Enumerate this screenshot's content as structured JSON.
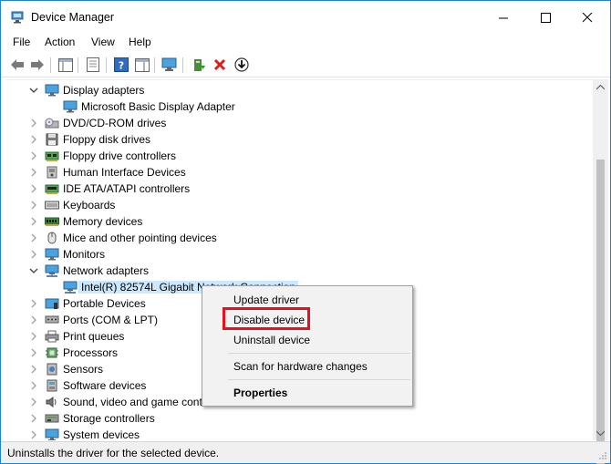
{
  "window": {
    "title": "Device Manager"
  },
  "menu": [
    "File",
    "Action",
    "View",
    "Help"
  ],
  "tree": [
    {
      "label": "Display adapters",
      "icon": "monitor-adapter-icon",
      "expanded": true,
      "level": 0
    },
    {
      "label": "Microsoft Basic Display Adapter",
      "icon": "monitor-adapter-icon",
      "level": 1
    },
    {
      "label": "DVD/CD-ROM drives",
      "icon": "dvd-drive-icon",
      "level": 0
    },
    {
      "label": "Floppy disk drives",
      "icon": "floppy-disk-icon",
      "level": 0
    },
    {
      "label": "Floppy drive controllers",
      "icon": "floppy-controller-icon",
      "level": 0
    },
    {
      "label": "Human Interface Devices",
      "icon": "hid-icon",
      "level": 0
    },
    {
      "label": "IDE ATA/ATAPI controllers",
      "icon": "ide-controller-icon",
      "level": 0
    },
    {
      "label": "Keyboards",
      "icon": "keyboard-icon",
      "level": 0
    },
    {
      "label": "Memory devices",
      "icon": "memory-icon",
      "level": 0
    },
    {
      "label": "Mice and other pointing devices",
      "icon": "mouse-icon",
      "level": 0
    },
    {
      "label": "Monitors",
      "icon": "monitor-icon",
      "level": 0
    },
    {
      "label": "Network adapters",
      "icon": "network-adapter-icon",
      "expanded": true,
      "level": 0
    },
    {
      "label": "Intel(R) 82574L Gigabit Network Connection",
      "icon": "network-adapter-icon",
      "level": 1,
      "selected": true
    },
    {
      "label": "Portable Devices",
      "icon": "portable-device-icon",
      "level": 0
    },
    {
      "label": "Ports (COM & LPT)",
      "icon": "port-icon",
      "level": 0
    },
    {
      "label": "Print queues",
      "icon": "printer-icon",
      "level": 0
    },
    {
      "label": "Processors",
      "icon": "processor-icon",
      "level": 0
    },
    {
      "label": "Sensors",
      "icon": "sensor-icon",
      "level": 0
    },
    {
      "label": "Software devices",
      "icon": "software-device-icon",
      "level": 0
    },
    {
      "label": "Sound, video and game controllers",
      "icon": "sound-icon",
      "level": 0
    },
    {
      "label": "Storage controllers",
      "icon": "storage-controller-icon",
      "level": 0
    },
    {
      "label": "System devices",
      "icon": "system-device-icon",
      "level": 0
    }
  ],
  "context_menu": {
    "update": "Update driver",
    "disable": "Disable device",
    "uninstall": "Uninstall device",
    "scan": "Scan for hardware changes",
    "properties": "Properties"
  },
  "status": {
    "text": "Uninstalls the driver for the selected device."
  },
  "colors": {
    "selection": "#cce8ff",
    "highlight_box": "#e8101c",
    "accent": "#1883d7"
  }
}
